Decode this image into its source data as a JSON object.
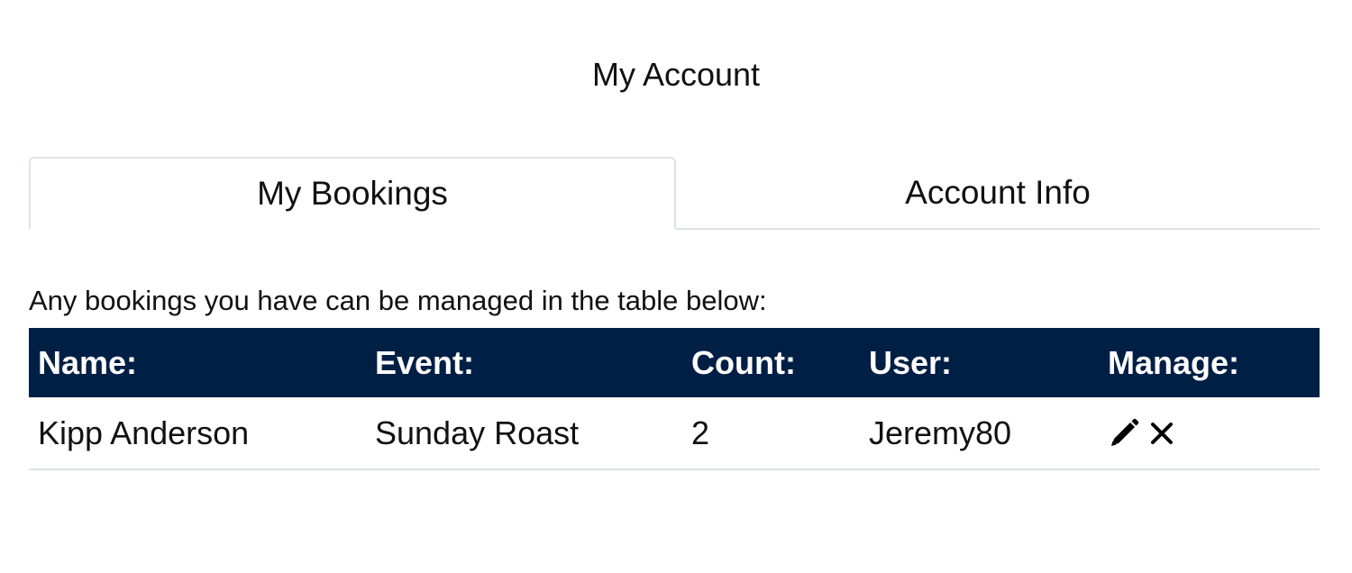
{
  "page": {
    "title": "My Account"
  },
  "tabs": [
    {
      "label": "My Bookings",
      "active": true
    },
    {
      "label": "Account Info",
      "active": false
    }
  ],
  "bookings": {
    "intro": "Any bookings you have can be managed in the table below:",
    "columns": [
      "Name:",
      "Event:",
      "Count:",
      "User:",
      "Manage:"
    ],
    "rows": [
      {
        "name": "Kipp Anderson",
        "event": "Sunday Roast",
        "count": "2",
        "user": "Jeremy80",
        "actions": [
          "pencil-icon",
          "close-icon"
        ]
      }
    ]
  },
  "colors": {
    "header_bg": "#001f45",
    "header_text": "#ffffff",
    "border": "#dee2e6"
  }
}
